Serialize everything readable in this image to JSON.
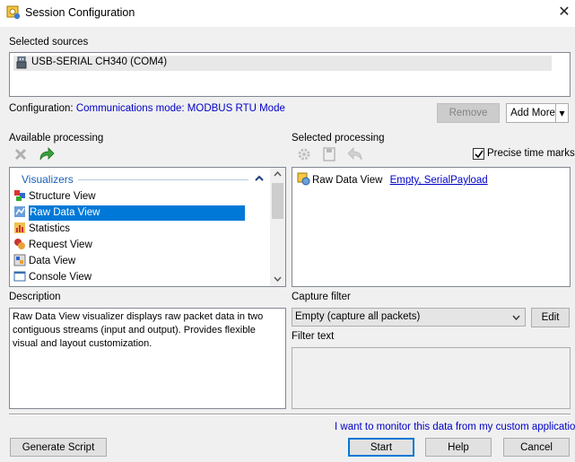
{
  "window": {
    "title": "Session Configuration",
    "close_glyph": "✕"
  },
  "sources": {
    "label": "Selected sources",
    "items": [
      "USB-SERIAL CH340 (COM4)"
    ]
  },
  "configuration": {
    "label": "Configuration:",
    "value": "Communications mode: MODBUS RTU Mode"
  },
  "buttons": {
    "remove": "Remove",
    "add_more": "Add More",
    "add_more_arrow": "▾",
    "edit": "Edit",
    "generate_script": "Generate Script",
    "start": "Start",
    "help": "Help",
    "cancel": "Cancel"
  },
  "available": {
    "label": "Available processing",
    "group": "Visualizers",
    "items": [
      {
        "label": "Structure View",
        "icon": "structure-view-icon"
      },
      {
        "label": "Raw Data View",
        "icon": "raw-data-view-icon",
        "selected": true
      },
      {
        "label": "Statistics",
        "icon": "statistics-icon"
      },
      {
        "label": "Request View",
        "icon": "request-view-icon"
      },
      {
        "label": "Data View",
        "icon": "data-view-icon"
      },
      {
        "label": "Console View",
        "icon": "console-view-icon"
      }
    ]
  },
  "selected_processing": {
    "label": "Selected processing",
    "precise_label": "Precise time marks",
    "precise_checked": true,
    "items": [
      {
        "label": "Raw Data View",
        "link": "Empty, SerialPayload"
      }
    ]
  },
  "description": {
    "label": "Description",
    "text": "Raw Data View visualizer displays raw packet data in two contiguous streams (input and output). Provides flexible visual and layout customization."
  },
  "capture_filter": {
    "label": "Capture filter",
    "value": "Empty (capture all packets)"
  },
  "filter_text": {
    "label": "Filter text"
  },
  "monitor_link": "I want to monitor this data from my custom application",
  "colors": {
    "accent": "#0078d7",
    "link": "#0000c8",
    "selection": "#0078d7"
  }
}
